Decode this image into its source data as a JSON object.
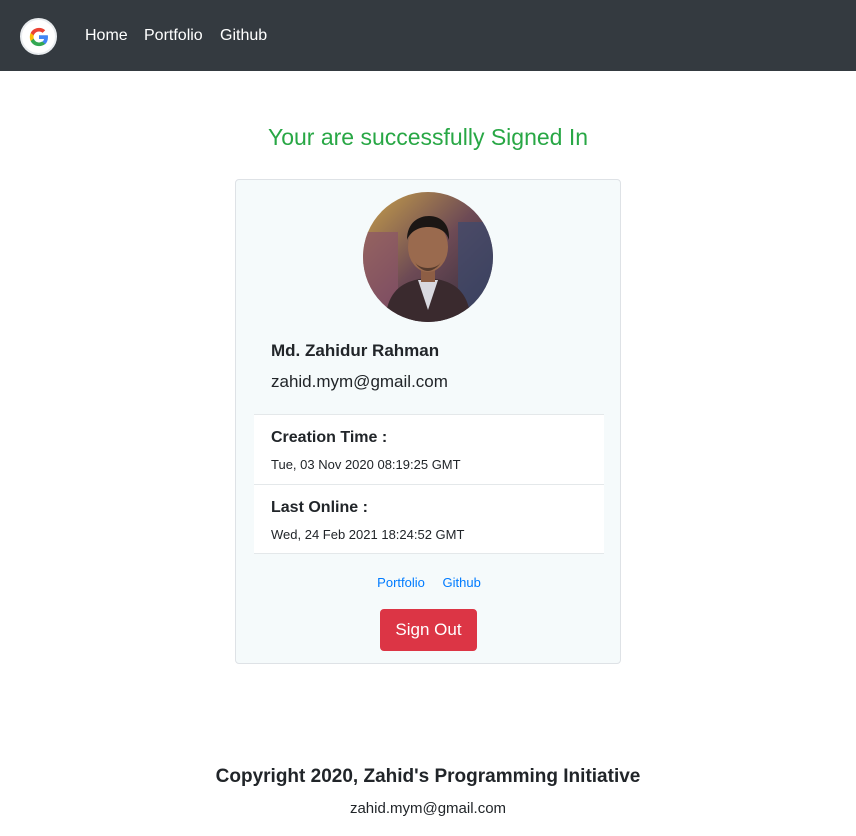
{
  "nav": {
    "brand_icon": "google-icon",
    "links": [
      {
        "label": "Home"
      },
      {
        "label": "Portfolio"
      },
      {
        "label": "Github"
      }
    ]
  },
  "main": {
    "headline": "Your are successfully Signed In",
    "profile": {
      "avatar_icon": "profile-photo",
      "name": "Md. Zahidur Rahman",
      "email": "zahid.mym@gmail.com"
    },
    "details": [
      {
        "title": "Creation Time :",
        "value": "Tue, 03 Nov 2020 08:19:25 GMT"
      },
      {
        "title": "Last Online :",
        "value": "Wed, 24 Feb 2021 18:24:52 GMT"
      }
    ],
    "card_links": [
      {
        "label": "Portfolio"
      },
      {
        "label": "Github"
      }
    ],
    "signout_label": "Sign Out"
  },
  "footer": {
    "title": "Copyright 2020, Zahid's Programming Initiative",
    "email": "zahid.mym@gmail.com"
  },
  "colors": {
    "navbar": "#343a40",
    "success": "#28a745",
    "danger": "#dc3545",
    "link": "#007bff"
  }
}
